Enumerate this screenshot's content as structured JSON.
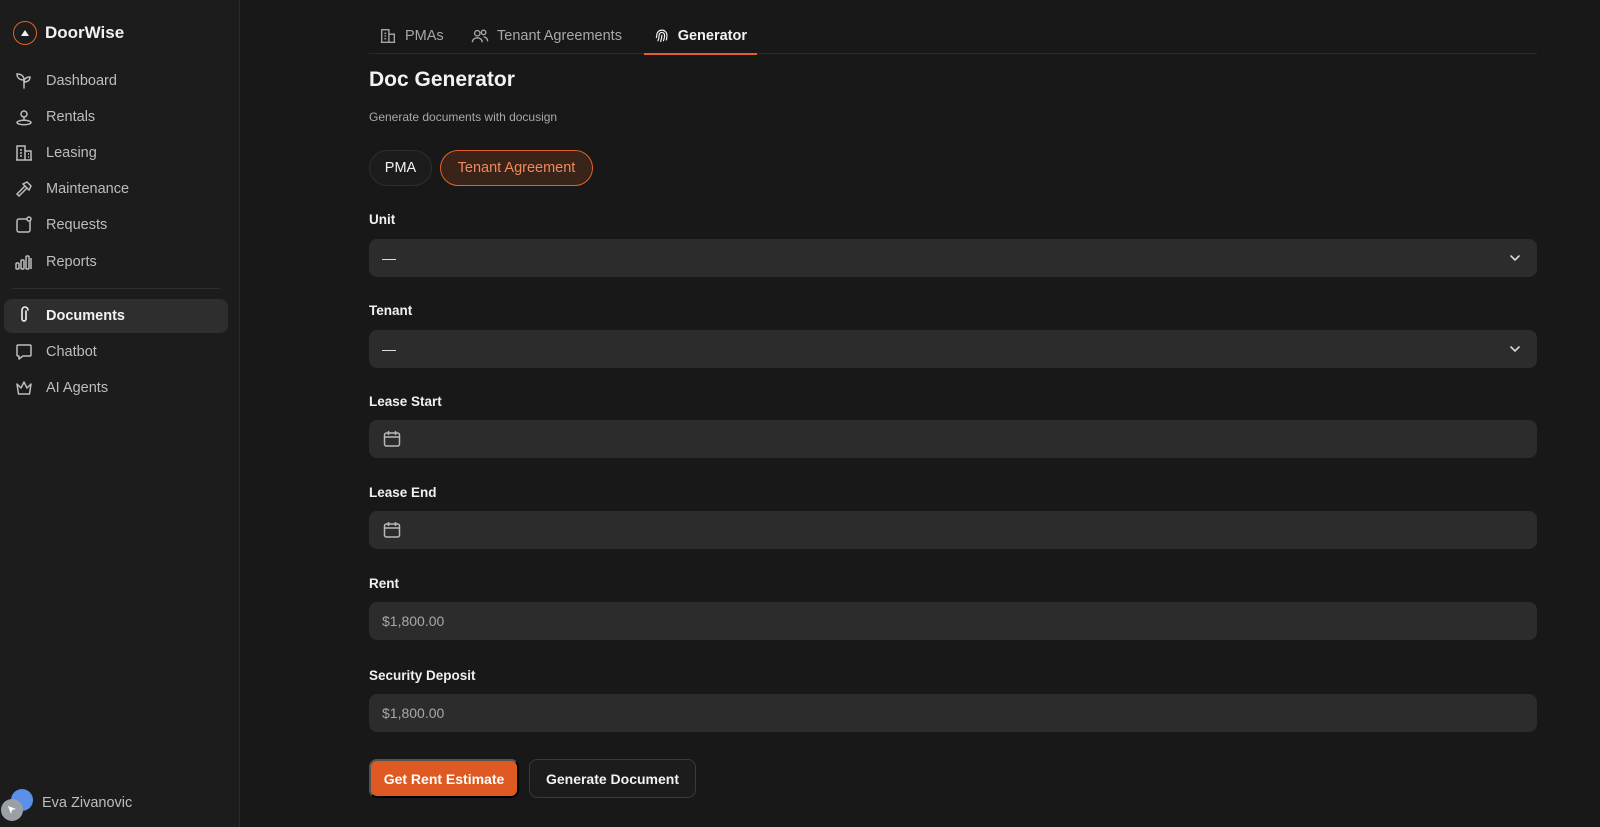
{
  "app": {
    "name": "DoorWise"
  },
  "sidebar": {
    "items": [
      {
        "label": "Dashboard",
        "icon": "sprout-icon"
      },
      {
        "label": "Rentals",
        "icon": "map-pin-icon"
      },
      {
        "label": "Leasing",
        "icon": "building-icon"
      },
      {
        "label": "Maintenance",
        "icon": "hammer-icon"
      },
      {
        "label": "Requests",
        "icon": "request-icon"
      },
      {
        "label": "Reports",
        "icon": "bar-chart-icon"
      },
      {
        "label": "Documents",
        "icon": "paperclip-icon",
        "active": true
      },
      {
        "label": "Chatbot",
        "icon": "message-icon"
      },
      {
        "label": "AI Agents",
        "icon": "crown-icon"
      }
    ],
    "user": {
      "name": "Eva Zivanovic"
    }
  },
  "tabs": [
    {
      "label": "PMAs",
      "icon": "building-icon"
    },
    {
      "label": "Tenant Agreements",
      "icon": "users-icon"
    },
    {
      "label": "Generator",
      "icon": "fingerprint-icon",
      "active": true
    }
  ],
  "page": {
    "title": "Doc Generator",
    "subtitle": "Generate documents with docusign"
  },
  "doc_type": {
    "options": [
      "PMA",
      "Tenant Agreement"
    ],
    "selected": "Tenant Agreement"
  },
  "form": {
    "unit": {
      "label": "Unit",
      "value": "—"
    },
    "tenant": {
      "label": "Tenant",
      "value": "—"
    },
    "lease_start": {
      "label": "Lease Start",
      "value": ""
    },
    "lease_end": {
      "label": "Lease End",
      "value": ""
    },
    "rent": {
      "label": "Rent",
      "placeholder": "$1,800.00"
    },
    "security_deposit": {
      "label": "Security Deposit",
      "placeholder": "$1,800.00"
    }
  },
  "actions": {
    "estimate_label": "Get Rent Estimate",
    "generate_label": "Generate Document"
  },
  "colors": {
    "accent": "#df5a22",
    "background": "#181818",
    "sidebar": "#1c1c1c",
    "field": "#2c2c2c"
  }
}
